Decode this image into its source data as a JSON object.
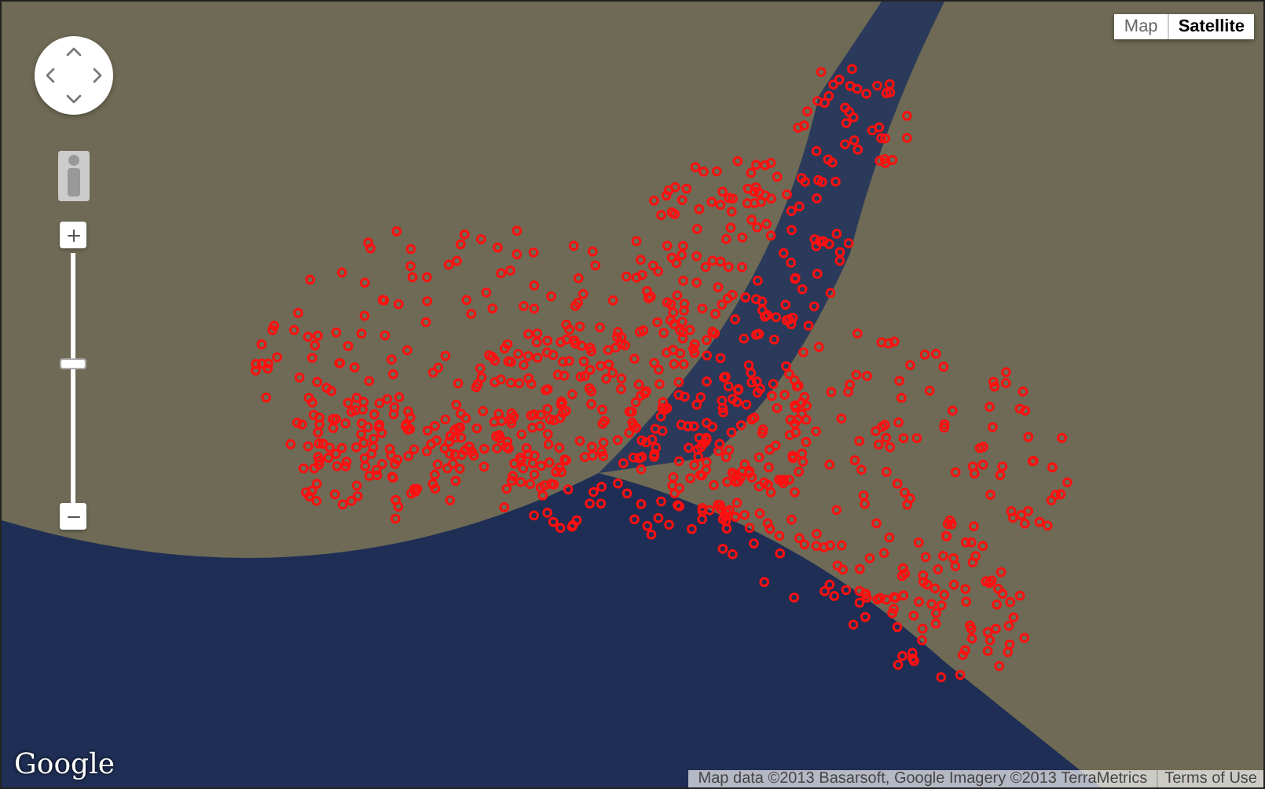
{
  "map_type": [
    {
      "label": "Map",
      "selected": false
    },
    {
      "label": "Satellite",
      "selected": true
    }
  ],
  "zoom": {
    "level": 0.56
  },
  "logo": "Google",
  "attribution": "Map data ©2013 Basarsoft, Google Imagery ©2013 TerraMetrics",
  "terms_link": "Terms of Use"
}
